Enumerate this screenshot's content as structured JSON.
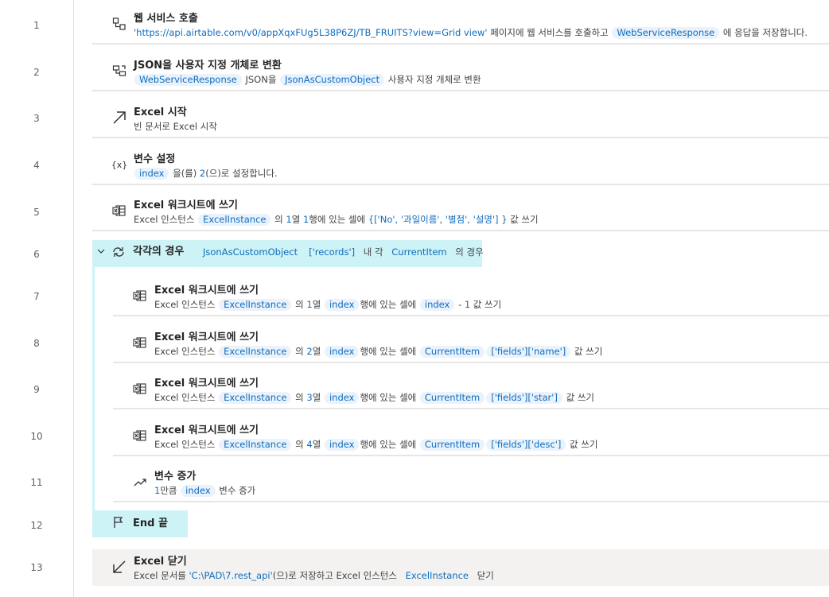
{
  "line_numbers": [
    "1",
    "2",
    "3",
    "4",
    "5",
    "6",
    "7",
    "8",
    "9",
    "10",
    "11",
    "12",
    "13"
  ],
  "steps": {
    "s1": {
      "title": "웹 서비스 호출",
      "url": "'https://api.airtable.com/v0/appXqxFUg5L38P6ZJ/TB_FRUITS?view=Grid view'",
      "t1": " 페이지에 웹 서비스를 호출하고 ",
      "var": "WebServiceResponse",
      "t2": " 에 응답을 저장합니다."
    },
    "s2": {
      "title": "JSON을 사용자 지정 개체로 변환",
      "var1": "WebServiceResponse",
      "t1": " JSON을 ",
      "var2": "JsonAsCustomObject",
      "t2": " 사용자 지정 개체로 변환"
    },
    "s3": {
      "title": "Excel 시작",
      "desc": "빈 문서로 Excel 시작"
    },
    "s4": {
      "title": "변수 설정",
      "var": "index",
      "t1": " 을(를) ",
      "num": "2",
      "t2": "(으)로 설정합니다."
    },
    "s5": {
      "title": "Excel 워크시트에 쓰기",
      "t0": "Excel 인스턴스 ",
      "var": "ExcelInstance",
      "t1": " 의 ",
      "col": "1",
      "t2": "열 ",
      "row": "1",
      "t3": "행에 있는 셀에 ",
      "list": "{['No', '과일이름', '별점', '설명'] }",
      "t4": " 값 쓰기"
    },
    "s6": {
      "title": "각각의 경우",
      "var1": "JsonAsCustomObject",
      "key": "['records']",
      "t1": " 내 각 ",
      "var2": "CurrentItem",
      "t2": " 의 경우"
    },
    "s7": {
      "title": "Excel 워크시트에 쓰기",
      "t0": "Excel 인스턴스 ",
      "var": "ExcelInstance",
      "t1": " 의 ",
      "col": "1",
      "t2": "열 ",
      "row": "index",
      "t3": "행에 있는 셀에 ",
      "val": "index",
      "t4": " - ",
      "num": "1",
      "t5": " 값 쓰기"
    },
    "s8": {
      "title": "Excel 워크시트에 쓰기",
      "t0": "Excel 인스턴스 ",
      "var": "ExcelInstance",
      "t1": " 의 ",
      "col": "2",
      "t2": "열 ",
      "row": "index",
      "t3": "행에 있는 셀에 ",
      "val": "CurrentItem",
      "key": "['fields']['name']",
      "t4": " 값 쓰기"
    },
    "s9": {
      "title": "Excel 워크시트에 쓰기",
      "t0": "Excel 인스턴스 ",
      "var": "ExcelInstance",
      "t1": " 의 ",
      "col": "3",
      "t2": "열 ",
      "row": "index",
      "t3": "행에 있는 셀에 ",
      "val": "CurrentItem",
      "key": "['fields']['star']",
      "t4": " 값 쓰기"
    },
    "s10": {
      "title": "Excel 워크시트에 쓰기",
      "t0": "Excel 인스턴스 ",
      "var": "ExcelInstance",
      "t1": " 의 ",
      "col": "4",
      "t2": "열 ",
      "row": "index",
      "t3": "행에 있는 셀에 ",
      "val": "CurrentItem",
      "key": "['fields']['desc']",
      "t4": " 값 쓰기"
    },
    "s11": {
      "title": "변수 증가",
      "num": "1",
      "t1": "만큼 ",
      "var": "index",
      "t2": " 변수 증가"
    },
    "s12": {
      "title": "End 끝"
    },
    "s13": {
      "title": "Excel 닫기",
      "t0": "Excel 문서를 ",
      "path": "'C:\\PAD\\7.rest_api'",
      "t1": "(으)로 저장하고 Excel 인스턴스 ",
      "var": "ExcelInstance",
      "t2": " 닫기"
    }
  },
  "colors": {
    "accent": "#0f6cbd",
    "loop_highlight": "#cdf3f6",
    "token_bg": "#eaf2fc"
  },
  "icons": {
    "s1": "web-service-icon",
    "s2": "convert-json-icon",
    "s3": "excel-launch-icon",
    "s4": "variable-icon",
    "s5": "excel-write-icon",
    "s6": "loop-icon",
    "s11": "increase-variable-icon",
    "s12": "end-flag-icon",
    "s13": "excel-close-icon"
  }
}
